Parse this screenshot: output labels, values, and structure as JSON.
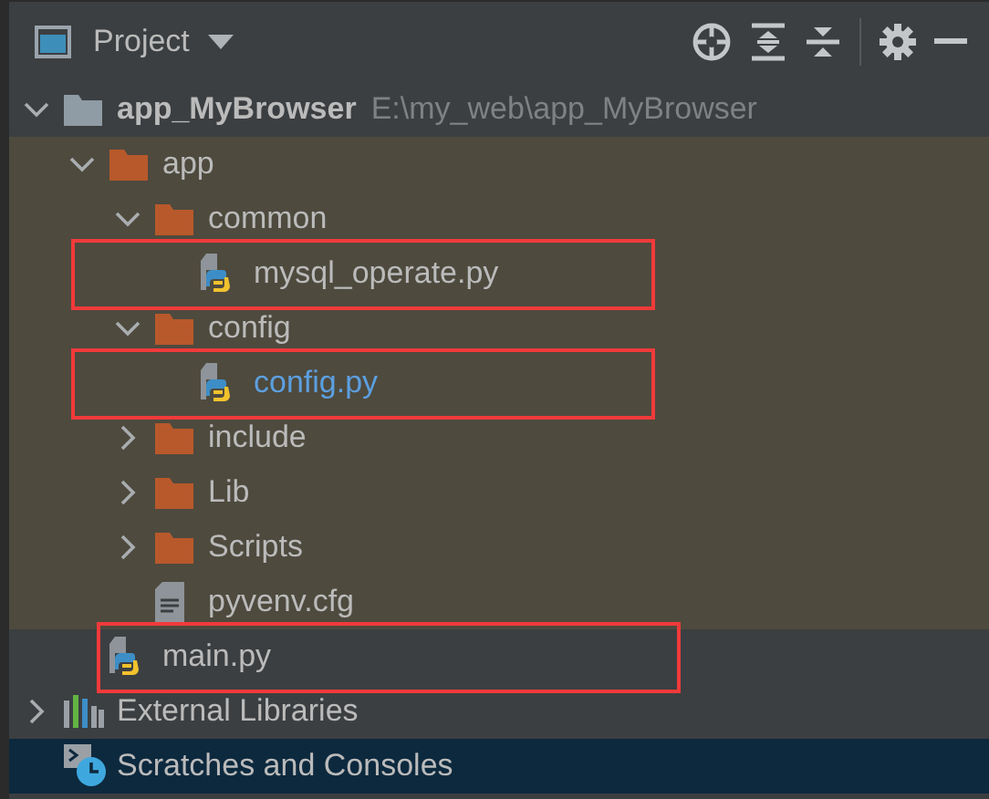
{
  "header": {
    "title": "Project"
  },
  "tree": [
    {
      "name": "app_MyBrowser",
      "path": "E:\\my_web\\app_MyBrowser",
      "kind": "project",
      "expanded": true,
      "selected": false,
      "children": [
        {
          "name": "app",
          "kind": "folder",
          "expanded": true,
          "selected": false,
          "tinted": true,
          "children": [
            {
              "name": "common",
              "kind": "folder",
              "expanded": true,
              "selected": false,
              "children": [
                {
                  "name": "mysql_operate.py",
                  "kind": "py",
                  "selected": false,
                  "boxed": true,
                  "modified": false
                }
              ]
            },
            {
              "name": "config",
              "kind": "folder",
              "expanded": true,
              "selected": false,
              "children": [
                {
                  "name": "config.py",
                  "kind": "py",
                  "selected": false,
                  "boxed": true,
                  "modified": true
                }
              ]
            },
            {
              "name": "include",
              "kind": "folder",
              "expanded": false,
              "selected": false
            },
            {
              "name": "Lib",
              "kind": "folder",
              "expanded": false,
              "selected": false
            },
            {
              "name": "Scripts",
              "kind": "folder",
              "expanded": false,
              "selected": false
            },
            {
              "name": "pyvenv.cfg",
              "kind": "file",
              "selected": false
            }
          ]
        },
        {
          "name": "main.py",
          "kind": "py",
          "selected": false,
          "boxed": true,
          "modified": false
        }
      ]
    },
    {
      "name": "External Libraries",
      "kind": "libraries",
      "expanded": false,
      "selected": false
    },
    {
      "name": "Scratches and Consoles",
      "kind": "scratches",
      "selected": true
    }
  ]
}
